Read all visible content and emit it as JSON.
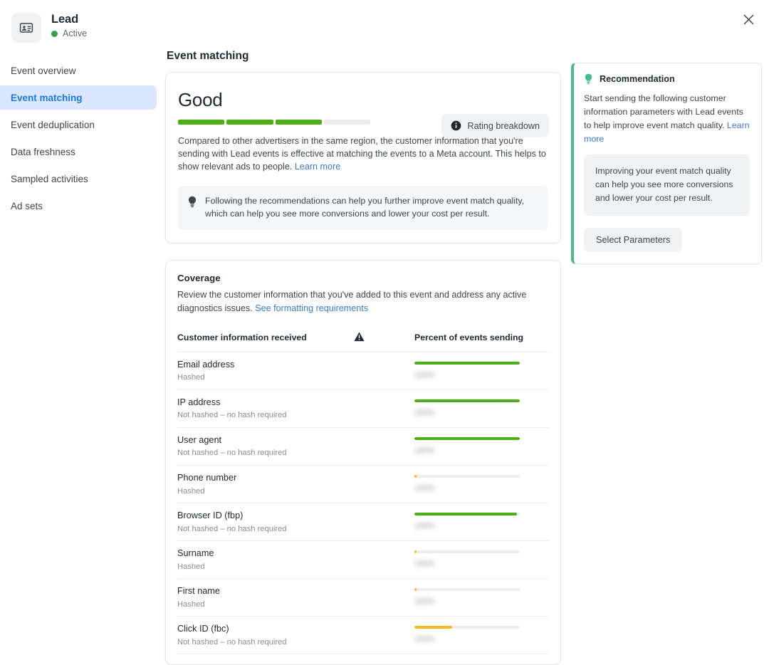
{
  "header": {
    "icon": "contact-card-icon",
    "title": "Lead",
    "status_label": "Active",
    "status_color": "#31a24c",
    "close_icon": "close-icon"
  },
  "sidebar": {
    "items": [
      {
        "label": "Event overview",
        "active": false
      },
      {
        "label": "Event matching",
        "active": true
      },
      {
        "label": "Event deduplication",
        "active": false
      },
      {
        "label": "Data freshness",
        "active": false
      },
      {
        "label": "Sampled activities",
        "active": false
      },
      {
        "label": "Ad sets",
        "active": false
      }
    ],
    "active_color": "#1877f2",
    "active_bg": "#dbe7ff"
  },
  "main": {
    "page_title": "Event matching",
    "rating": {
      "value": "Good",
      "segments_total": 4,
      "segments_filled": 3,
      "fill_color": "#4caf16",
      "track_color": "#ececec",
      "breakdown_button": {
        "label": "Rating breakdown",
        "icon": "info-icon"
      },
      "description_1": "Compared to other advertisers in the same region, the customer information that you're sending with Lead events is effective at matching the events to a Meta account. This helps to show relevant ads to people. ",
      "description_link": "Learn more",
      "tip": {
        "icon": "lightbulb-icon",
        "text": "Following the recommendations can help you further improve event match quality, which can help you see more conversions and lower your cost per result."
      }
    },
    "coverage": {
      "title": "Coverage",
      "description": "Review the customer information that you've added to this event and address any active diagnostics issues. ",
      "description_link": "See formatting requirements",
      "columns": {
        "name": "Customer information received",
        "warning_icon": "warning-triangle-icon",
        "percent": "Percent of events sending"
      },
      "percent_label_redacted": "100%",
      "rows": [
        {
          "name": "Email address",
          "sub": "Hashed",
          "percent": 100,
          "color": "#4caf16"
        },
        {
          "name": "IP address",
          "sub": "Not hashed – no hash required",
          "percent": 100,
          "color": "#4caf16"
        },
        {
          "name": "User agent",
          "sub": "Not hashed – no hash required",
          "percent": 100,
          "color": "#4caf16"
        },
        {
          "name": "Phone number",
          "sub": "Hashed",
          "percent": 2,
          "color": "#f7b928"
        },
        {
          "name": "Browser ID (fbp)",
          "sub": "Not hashed – no hash required",
          "percent": 97,
          "color": "#4caf16"
        },
        {
          "name": "Surname",
          "sub": "Hashed",
          "percent": 2,
          "color": "#f7b928"
        },
        {
          "name": "First name",
          "sub": "Hashed",
          "percent": 2,
          "color": "#f7b928"
        },
        {
          "name": "Click ID (fbc)",
          "sub": "Not hashed – no hash required",
          "percent": 36,
          "color": "#f7b928"
        }
      ]
    }
  },
  "recommendation": {
    "icon": "lightbulb-icon",
    "accent_color": "#45bd8a",
    "title": "Recommendation",
    "body": "Start sending the following customer information parameters with Lead events to help improve event match quality. ",
    "body_link": "Learn more",
    "inner_note": "Improving your event match quality can help you see more conversions and lower your cost per result.",
    "button_label": "Select Parameters"
  }
}
